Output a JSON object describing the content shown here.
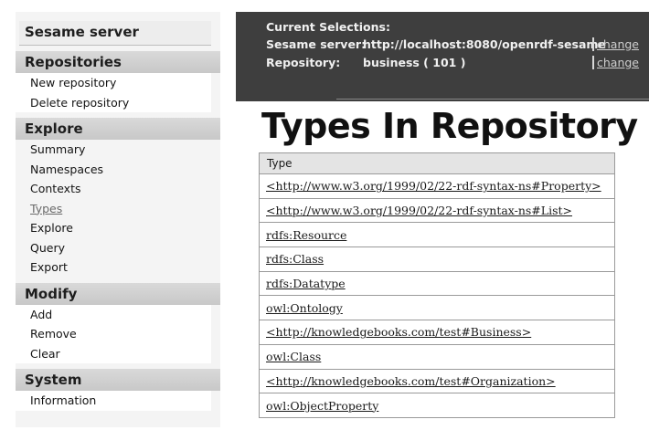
{
  "sidebar": {
    "title": "Sesame server",
    "sections": {
      "repositories": {
        "label": "Repositories",
        "items": [
          "New repository",
          "Delete repository"
        ]
      },
      "explore": {
        "label": "Explore",
        "items": [
          "Summary",
          "Namespaces",
          "Contexts",
          "Types",
          "Explore",
          "Query",
          "Export"
        ],
        "active": "Types"
      },
      "modify": {
        "label": "Modify",
        "items": [
          "Add",
          "Remove",
          "Clear"
        ]
      },
      "system": {
        "label": "System",
        "items": [
          "Information"
        ]
      }
    }
  },
  "selections": {
    "heading": "Current Selections:",
    "server_label": "Sesame server:",
    "server_value": "http://localhost:8080/openrdf-sesame",
    "repository_label": "Repository:",
    "repository_value": "business ( 101 )",
    "change_label": "change"
  },
  "main": {
    "title": "Types In Repository",
    "table": {
      "header": "Type",
      "rows": [
        "<http://www.w3.org/1999/02/22-rdf-syntax-ns#Property>",
        "<http://www.w3.org/1999/02/22-rdf-syntax-ns#List>",
        "rdfs:Resource",
        "rdfs:Class",
        "rdfs:Datatype",
        "owl:Ontology",
        "<http://knowledgebooks.com/test#Business>",
        "owl:Class",
        "<http://knowledgebooks.com/test#Organization>",
        "owl:ObjectProperty"
      ]
    }
  }
}
